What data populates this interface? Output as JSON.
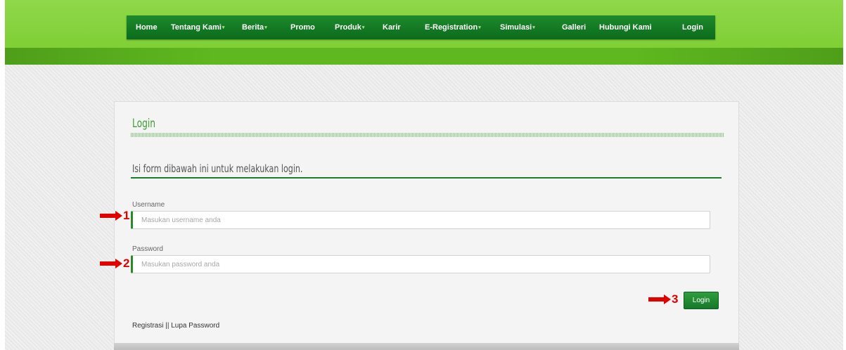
{
  "nav": {
    "items": [
      {
        "label": "Home",
        "dropdown": false
      },
      {
        "label": "Tentang Kami",
        "dropdown": true
      },
      {
        "label": "Berita",
        "dropdown": true
      },
      {
        "label": "Promo",
        "dropdown": false
      },
      {
        "label": "Produk",
        "dropdown": true
      },
      {
        "label": "Karir",
        "dropdown": false
      },
      {
        "label": "E-Registration",
        "dropdown": true
      },
      {
        "label": "Simulasi",
        "dropdown": true
      },
      {
        "label": "Galleri",
        "dropdown": false
      },
      {
        "label": "Hubungi Kami",
        "dropdown": false
      },
      {
        "label": "Login",
        "dropdown": false
      }
    ],
    "caret_glyph": "▾"
  },
  "login": {
    "title": "Login",
    "subtitle": "Isi form dibawah ini untuk melakukan login.",
    "username_label": "Username",
    "username_placeholder": "Masukan username anda",
    "password_label": "Password",
    "password_placeholder": "Masukan password anda",
    "submit_label": "Login"
  },
  "annotations": {
    "step1": "1",
    "step2": "2",
    "step3": "3"
  },
  "footer": {
    "register_label": "Registrasi",
    "separator": " || ",
    "forgot_label": "Lupa Password"
  },
  "colors": {
    "nav_bg": "#0b6b1c",
    "header_green": "#7fcf35",
    "accent_green": "#2a8a2a",
    "title_green": "#3f9c36",
    "annotation_red": "#e00000"
  }
}
